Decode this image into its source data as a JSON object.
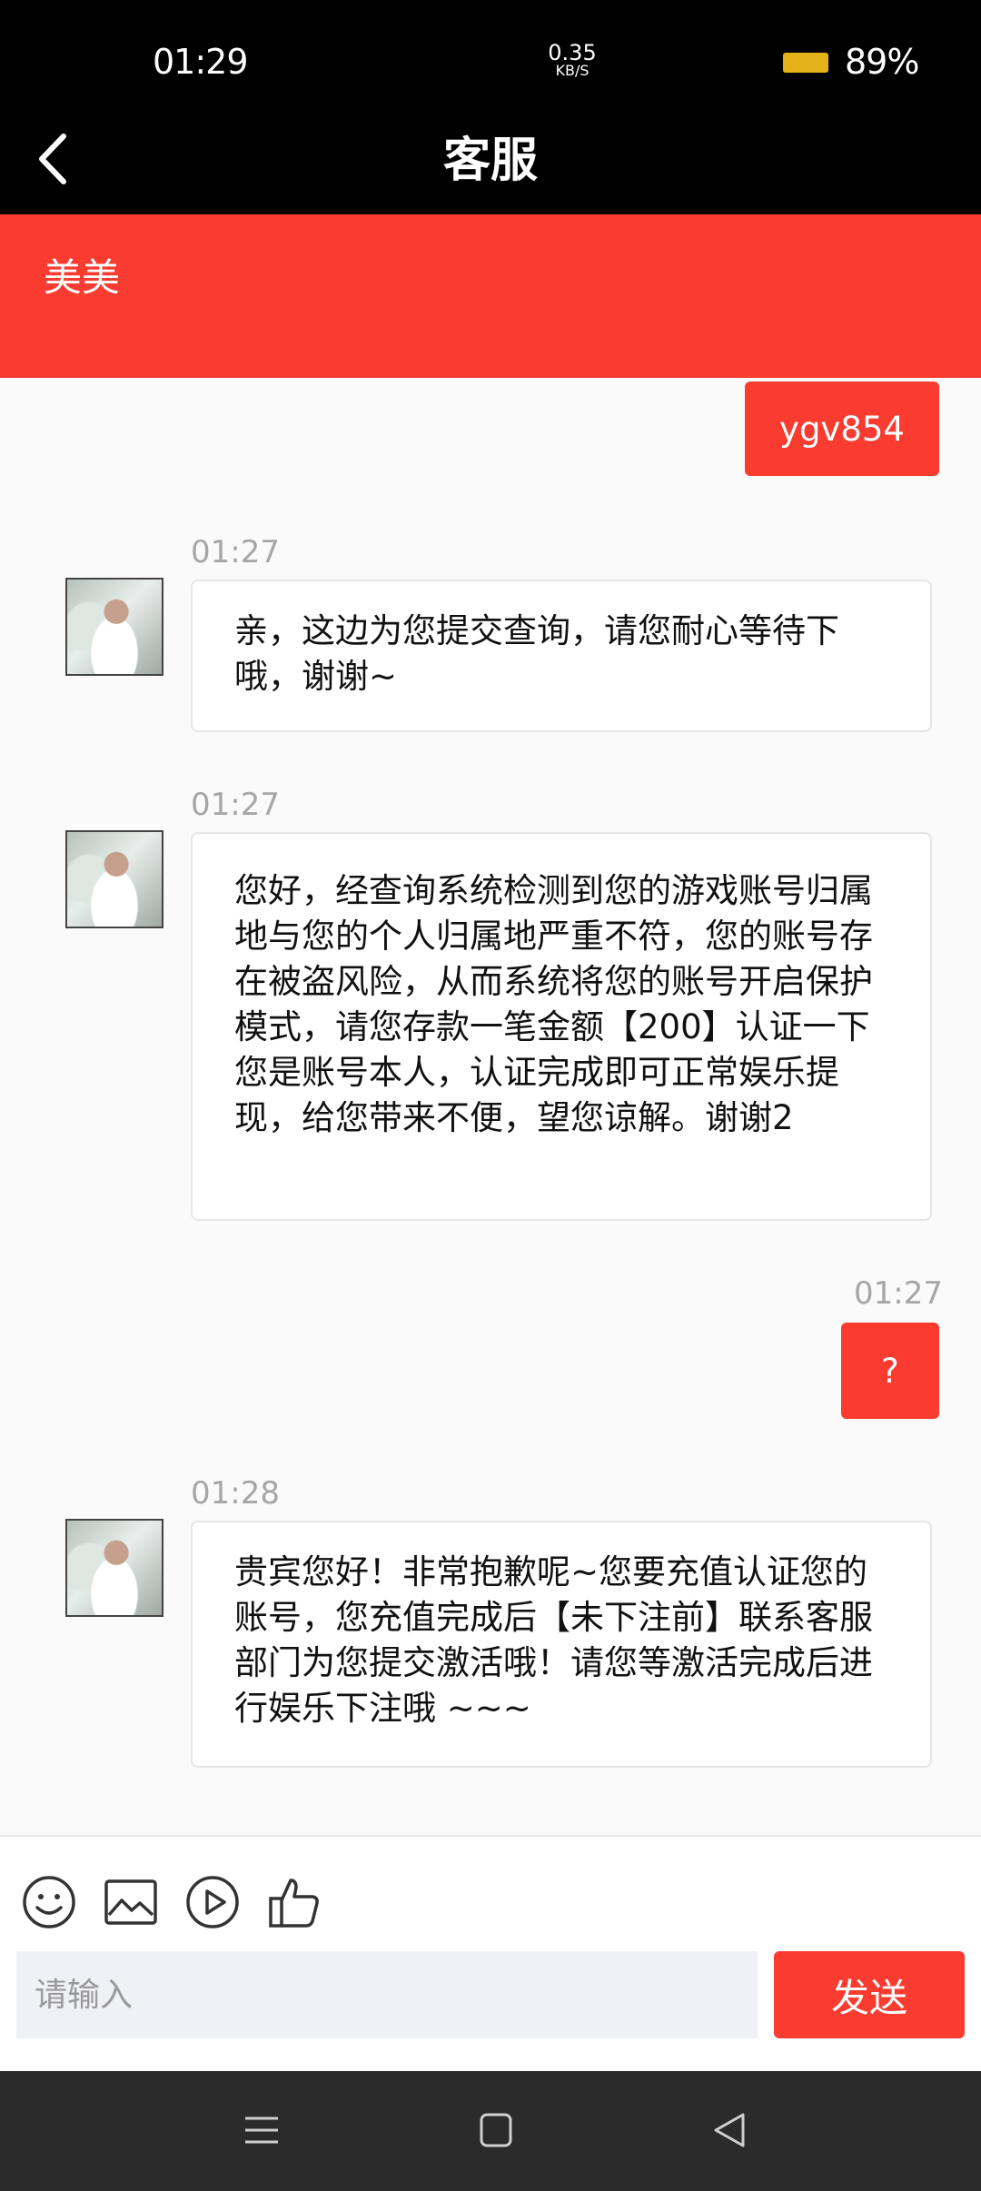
{
  "status_bar": {
    "time": "01:29",
    "net_speed_value": "0.35",
    "net_speed_unit": "KB/S",
    "battery_pct": "89%"
  },
  "header": {
    "title": "客服"
  },
  "agent": {
    "name": "美美"
  },
  "messages": [
    {
      "from": "user",
      "time": "",
      "text": "ygv854"
    },
    {
      "from": "agent",
      "time": "01:27",
      "text": "亲，这边为您提交查询，请您耐心等待下哦，谢谢~"
    },
    {
      "from": "agent",
      "time": "01:27",
      "text": "您好，经查询系统检测到您的游戏账号归属地与您的个人归属地严重不符，您的账号存在被盗风险，从而系统将您的账号开启保护模式，请您存款一笔金额【200】认证一下您是账号本人，认证完成即可正常娱乐提现，给您带来不便，望您谅解。谢谢2"
    },
    {
      "from": "user",
      "time": "01:27",
      "text": "?"
    },
    {
      "from": "agent",
      "time": "01:28",
      "text": "贵宾您好！非常抱歉呢~您要充值认证您的账号，您充值完成后【未下注前】联系客服部门为您提交激活哦！请您等激活完成后进行娱乐下注哦 ~~~"
    }
  ],
  "toolbar": {
    "icons": [
      "emoji-icon",
      "image-icon",
      "play-icon",
      "thumbs-up-icon"
    ]
  },
  "input": {
    "placeholder": "请输入",
    "value": ""
  },
  "send_label": "发送",
  "colors": {
    "accent": "#f93b30",
    "topbar": "#000000",
    "navbar": "#2b2b2b"
  }
}
